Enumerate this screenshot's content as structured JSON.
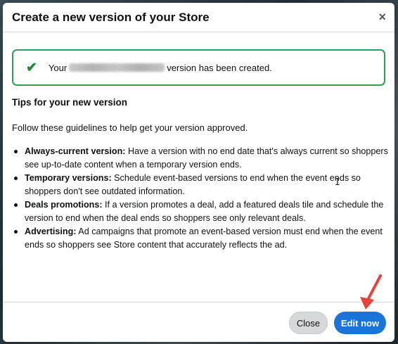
{
  "dialog": {
    "title": "Create a new version of your Store",
    "close_symbol": "×"
  },
  "alert": {
    "prefix": "Your",
    "suffix": "version has been created."
  },
  "tips": {
    "heading": "Tips for your new version",
    "intro": "Follow these guidelines to help get your version approved.",
    "items": [
      {
        "term": "Always-current version:",
        "text": " Have a version with no end date that's always current so shoppers see up-to-date content when a temporary version ends."
      },
      {
        "term": "Temporary versions:",
        "text": " Schedule event-based versions to end when the event ends so shoppers don't see outdated information."
      },
      {
        "term": "Deals promotions:",
        "text": " If a version promotes a deal, add a featured deals tile and schedule the version to end when the deal ends so shoppers see only relevant deals."
      },
      {
        "term": "Advertising:",
        "text": " Ad campaigns that promote an event-based version must end when the event ends so shoppers see Store content that accurately reflects the ad."
      }
    ]
  },
  "footer": {
    "close_label": "Close",
    "edit_label": "Edit now"
  },
  "colors": {
    "success": "#2e9e52",
    "primary": "#1a73d9",
    "annotation_arrow": "#e8403a"
  },
  "icons": [
    "check-icon",
    "close-icon",
    "arrow-annotation-icon",
    "text-cursor-icon"
  ]
}
